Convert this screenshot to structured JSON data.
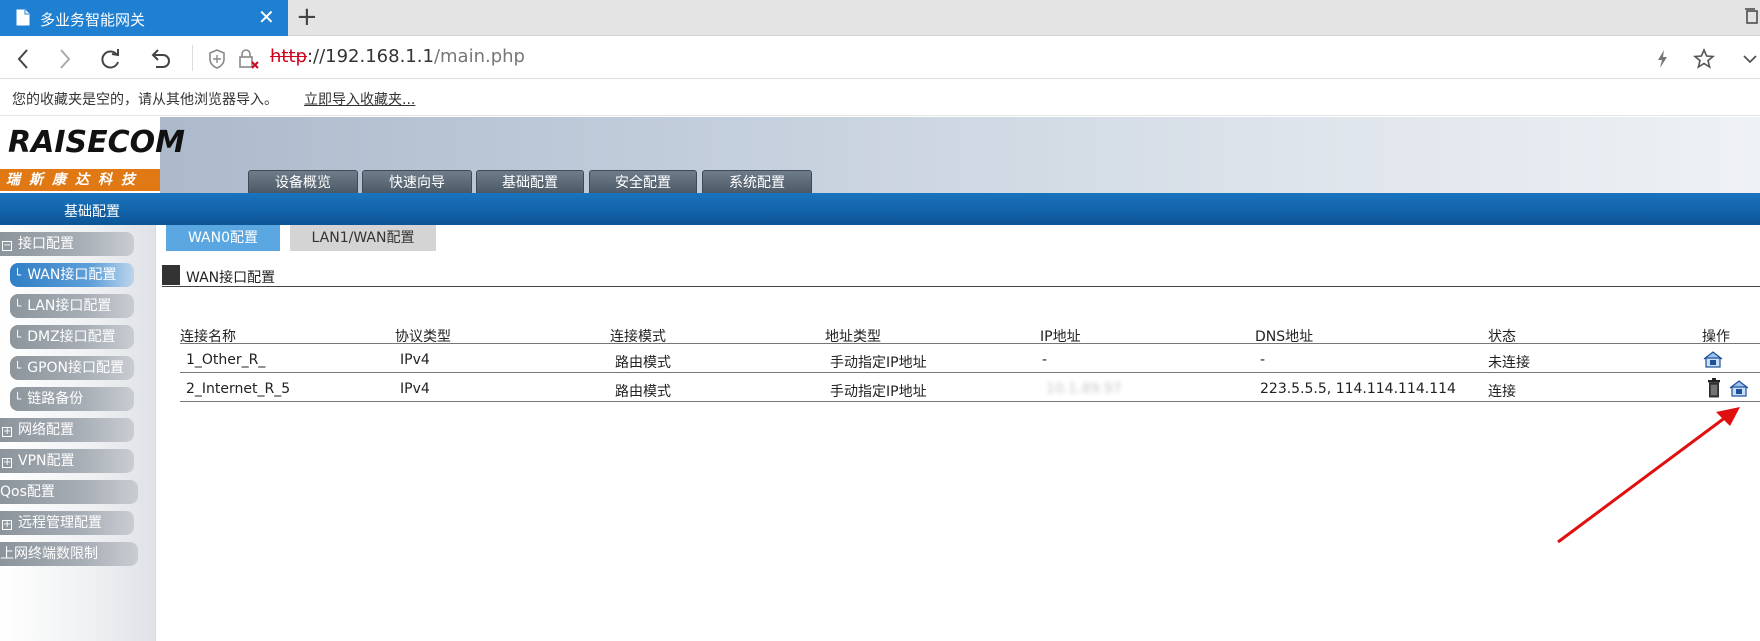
{
  "browser": {
    "tab_title": "多业务智能网关",
    "url_scheme": "http",
    "url_host": "://192.168.1.1",
    "url_path": "/main.php",
    "favorites_message": "您的收藏夹是空的，请从其他浏览器导入。",
    "favorites_import_link": "立即导入收藏夹..."
  },
  "header": {
    "logo_text": "RAISECOM",
    "logo_subtitle": "瑞斯康达科技",
    "menu_tabs": [
      {
        "label": "设备概览",
        "active": false
      },
      {
        "label": "快速向导",
        "active": false
      },
      {
        "label": "基础配置",
        "active": true
      },
      {
        "label": "安全配置",
        "active": false
      },
      {
        "label": "系统配置",
        "active": false
      }
    ]
  },
  "section_title": "基础配置",
  "sidebar": {
    "items": [
      {
        "label": "接口配置",
        "marker": "⊟"
      },
      {
        "label": "WAN接口配置",
        "child": true,
        "active": true
      },
      {
        "label": "LAN接口配置",
        "child": true
      },
      {
        "label": "DMZ接口配置",
        "child": true
      },
      {
        "label": "GPON接口配置",
        "child": true
      },
      {
        "label": "链路备份",
        "child": true
      },
      {
        "label": "网络配置",
        "marker": "⊞"
      },
      {
        "label": "VPN配置",
        "marker": "⊞"
      },
      {
        "label": "Qos配置"
      },
      {
        "label": "远程管理配置",
        "marker": "⊞"
      },
      {
        "label": "上网终端数限制"
      }
    ]
  },
  "subtabs": [
    {
      "label": "WAN0配置",
      "active": true
    },
    {
      "label": "LAN1/WAN配置",
      "active": false
    }
  ],
  "config_title": "WAN接口配置",
  "table": {
    "columns": [
      "连接名称",
      "协议类型",
      "连接模式",
      "地址类型",
      "IP地址",
      "DNS地址",
      "状态",
      "操作"
    ],
    "rows": [
      {
        "name": "1_Other_R_",
        "protocol": "IPv4",
        "mode": "路由模式",
        "addr_type": "手动指定IP地址",
        "ip": "-",
        "dns": "-",
        "status": "未连接",
        "actions": [
          "edit-icon"
        ]
      },
      {
        "name": "2_Internet_R_5",
        "protocol": "IPv4",
        "mode": "路由模式",
        "addr_type": "手动指定IP地址",
        "ip": "10.1.89.97",
        "dns": "223.5.5.5, 114.114.114.114",
        "status": "连接",
        "actions": [
          "trash-icon",
          "edit-icon"
        ]
      }
    ]
  },
  "colors": {
    "tab_active": "#1f7fd0",
    "section_bar": "#0c5596",
    "menu_tab_active": "#1164ad",
    "subtab_active": "#5aa6e0",
    "annotation_arrow": "#e01010"
  }
}
